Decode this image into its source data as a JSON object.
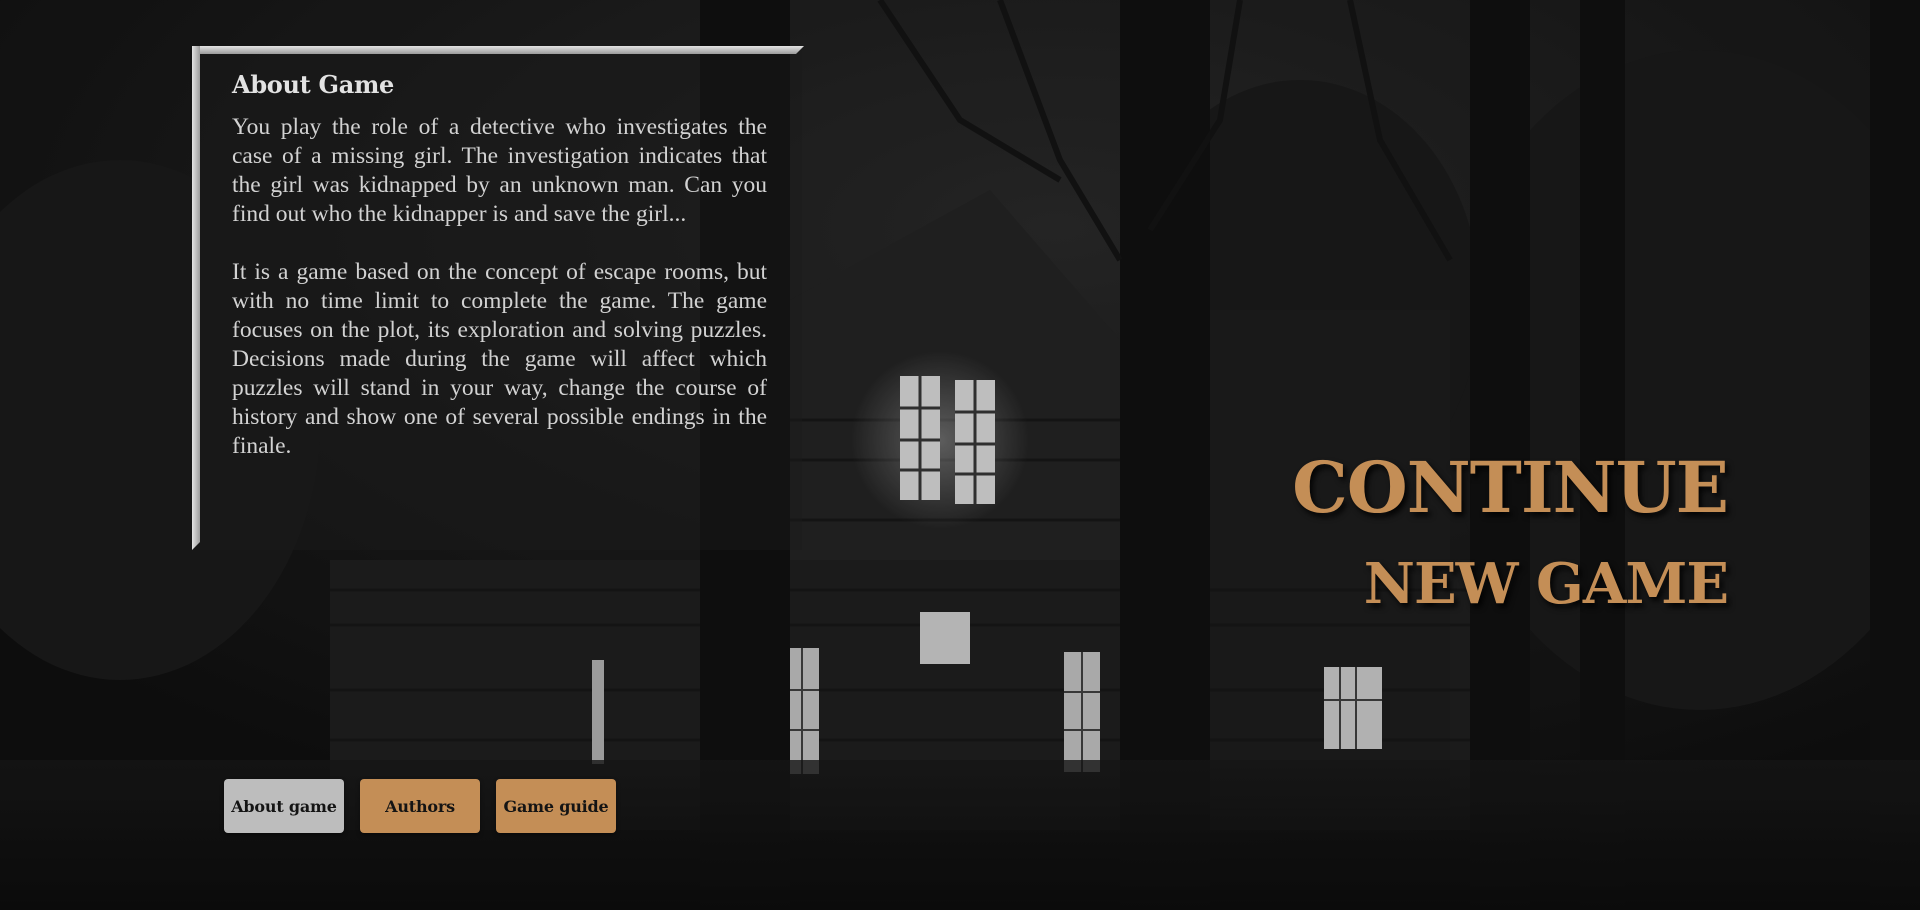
{
  "about": {
    "title": "About Game",
    "paragraphs": [
      "You play the role of a detective who investigates the case of a missing girl. The investigation indicates that the girl was kidnapped by an unknown man. Can you find out who the kidnapper is and save the girl...",
      "It is a game based on the concept of escape rooms, but with no time limit to complete the game. The game focuses on the plot, its exploration and solving puzzles. Decisions made during the game will affect which puzzles will stand in your way, change the course of history and show one of several possible endings in the finale."
    ]
  },
  "menu": {
    "continue_label": "CONTINUE",
    "new_game_label": "NEW GAME"
  },
  "bottom_buttons": {
    "about_label": "About game",
    "authors_label": "Authors",
    "guide_label": "Game guide",
    "active": "about"
  },
  "colors": {
    "accent": "#c48e56",
    "active_button": "#bdbdbd",
    "panel_frame": "#cfcfcf",
    "background": "#161616"
  }
}
